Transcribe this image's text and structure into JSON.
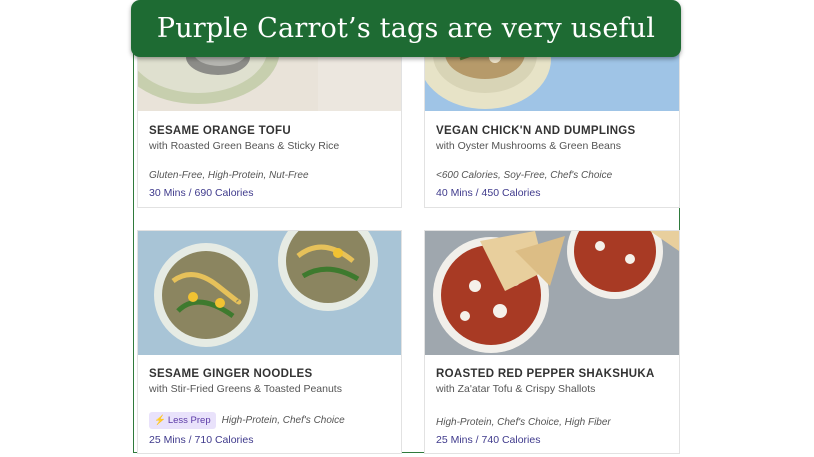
{
  "banner": {
    "text": "Purple Carrot’s tags are very useful"
  },
  "meals": [
    {
      "title": "SESAME ORANGE TOFU",
      "subtitle": "with Roasted Green Beans & Sticky Rice",
      "tags": "Gluten-Free, High-Protein, Nut-Free",
      "stats": "30 Mins / 690 Calories"
    },
    {
      "title": "VEGAN CHICK'N AND DUMPLINGS",
      "subtitle": "with Oyster Mushrooms & Green Beans",
      "tags": "<600 Calories, Soy-Free, Chef's Choice",
      "stats": "40 Mins / 450 Calories"
    },
    {
      "title": "SESAME GINGER NOODLES",
      "subtitle": "with Stir-Fried Greens & Toasted Peanuts",
      "badge": {
        "icon": "lightning-icon",
        "label": "Less Prep"
      },
      "tags": "High-Protein, Chef's Choice",
      "stats": "25 Mins / 710 Calories"
    },
    {
      "title": "ROASTED RED PEPPER SHAKSHUKA",
      "subtitle": "with Za'atar Tofu & Crispy Shallots",
      "tags": "High-Protein, Chef's Choice, High Fiber",
      "stats": "25 Mins / 740 Calories"
    }
  ]
}
